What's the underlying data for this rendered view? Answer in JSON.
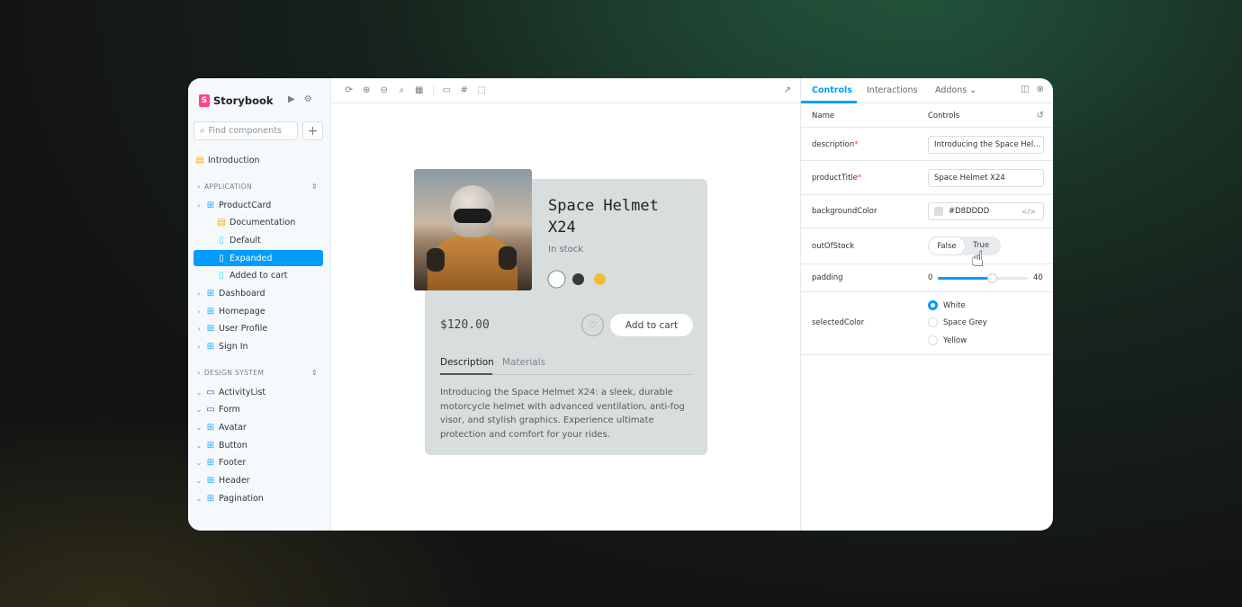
{
  "sidebar": {
    "brand": "Storybook",
    "search_placeholder": "Find components",
    "intro": "Introduction",
    "sections": [
      {
        "title": "APPLICATION"
      },
      {
        "title": "DESIGN SYSTEM"
      }
    ],
    "app_items": [
      {
        "label": "ProductCard",
        "icon": "component-icon"
      },
      {
        "label": "Documentation",
        "icon": "doc-icon"
      },
      {
        "label": "Default",
        "icon": "story-icon"
      },
      {
        "label": "Expanded",
        "icon": "story-icon",
        "active": true
      },
      {
        "label": "Added to cart",
        "icon": "story-icon"
      },
      {
        "label": "Dashboard",
        "icon": "component-icon"
      },
      {
        "label": "Homepage",
        "icon": "component-icon"
      },
      {
        "label": "User Profile",
        "icon": "component-icon"
      },
      {
        "label": "Sign In",
        "icon": "component-icon"
      }
    ],
    "ds_items": [
      {
        "label": "ActivityList",
        "icon": "folder-icon"
      },
      {
        "label": "Form",
        "icon": "folder-icon"
      },
      {
        "label": "Avatar",
        "icon": "component-icon"
      },
      {
        "label": "Button",
        "icon": "component-icon"
      },
      {
        "label": "Footer",
        "icon": "component-icon"
      },
      {
        "label": "Header",
        "icon": "component-icon"
      },
      {
        "label": "Pagination",
        "icon": "component-icon"
      }
    ]
  },
  "product": {
    "title": "Space Helmet X24",
    "stock": "In stock",
    "price": "$120.00",
    "add_to_cart": "Add to cart",
    "tab_description": "Description",
    "tab_materials": "Materials",
    "description": "Introducing the Space Helmet X24: a sleek, durable motorcycle helmet with advanced ventilation, anti-fog visor, and stylish graphics. Experience ultimate protection and comfort for your rides.",
    "swatch_colors": [
      "#FFFFFF",
      "#3A3A3A",
      "#F5BD2F"
    ]
  },
  "panel": {
    "tabs": [
      "Controls",
      "Interactions",
      "Addons"
    ],
    "header_name": "Name",
    "header_controls": "Controls",
    "controls": {
      "description_label": "description",
      "description_value": "Introducing the Space Hel...",
      "productTitle_label": "productTitle",
      "productTitle_value": "Space Helmet X24",
      "backgroundColor_label": "backgroundColor",
      "backgroundColor_value": "#D8DDDD",
      "outOfStock_label": "outOfStock",
      "outOfStock_false": "False",
      "outOfStock_true": "True",
      "padding_label": "padding",
      "padding_min": "0",
      "padding_max": "40",
      "padding_value_fraction": 0.6,
      "selectedColor_label": "selectedColor",
      "selectedColor_options": [
        "White",
        "Space Grey",
        "Yellow"
      ],
      "selectedColor_selected": "White"
    }
  },
  "colors": {
    "accent": "#029CFD",
    "brand": "#FF4785",
    "card_bg": "#D8DDDD"
  }
}
